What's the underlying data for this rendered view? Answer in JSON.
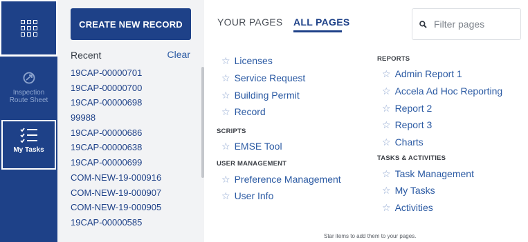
{
  "rail": {
    "apps_icon": "apps-grid-icon",
    "items": [
      {
        "label_line1": "Inspection",
        "label_line2": "Route Sheet",
        "icon": "route-icon"
      },
      {
        "label": "My Tasks",
        "icon": "checklist-icon"
      }
    ]
  },
  "recent": {
    "create_label": "CREATE NEW RECORD",
    "title": "Recent",
    "clear_label": "Clear",
    "items": [
      "19CAP-00000701",
      "19CAP-00000700",
      "19CAP-00000698",
      "99988",
      "19CAP-00000686",
      "19CAP-00000638",
      "19CAP-00000699",
      "COM-NEW-19-000916",
      "COM-NEW-19-000907",
      "COM-NEW-19-000905",
      "19CAP-00000585"
    ]
  },
  "tabs": {
    "your_pages": "YOUR PAGES",
    "all_pages": "ALL PAGES"
  },
  "filter": {
    "placeholder": "Filter pages",
    "icon": "search-icon"
  },
  "pages_left": {
    "top_items": [
      "Licenses",
      "Service Request",
      "Building Permit",
      "Record"
    ],
    "scripts_heading": "SCRIPTS",
    "scripts_items": [
      "EMSE Tool"
    ],
    "user_mgmt_heading": "USER MANAGEMENT",
    "user_mgmt_items": [
      "Preference Management",
      "User Info"
    ]
  },
  "pages_right": {
    "reports_heading": "REPORTS",
    "reports_items": [
      "Admin Report 1",
      "Accela Ad Hoc Reporting",
      "Report 2",
      "Report 3",
      "Charts"
    ],
    "tasks_heading": "TASKS & ACTIVITIES",
    "tasks_items": [
      "Task Management",
      "My Tasks",
      "Activities"
    ]
  },
  "hint": "Star items to add them to your pages.",
  "colors": {
    "brand_navy": "#1e4188",
    "link_blue": "#2b5aa3",
    "star_blue": "#8aa3cf",
    "panel_gray": "#f2f3f5"
  }
}
